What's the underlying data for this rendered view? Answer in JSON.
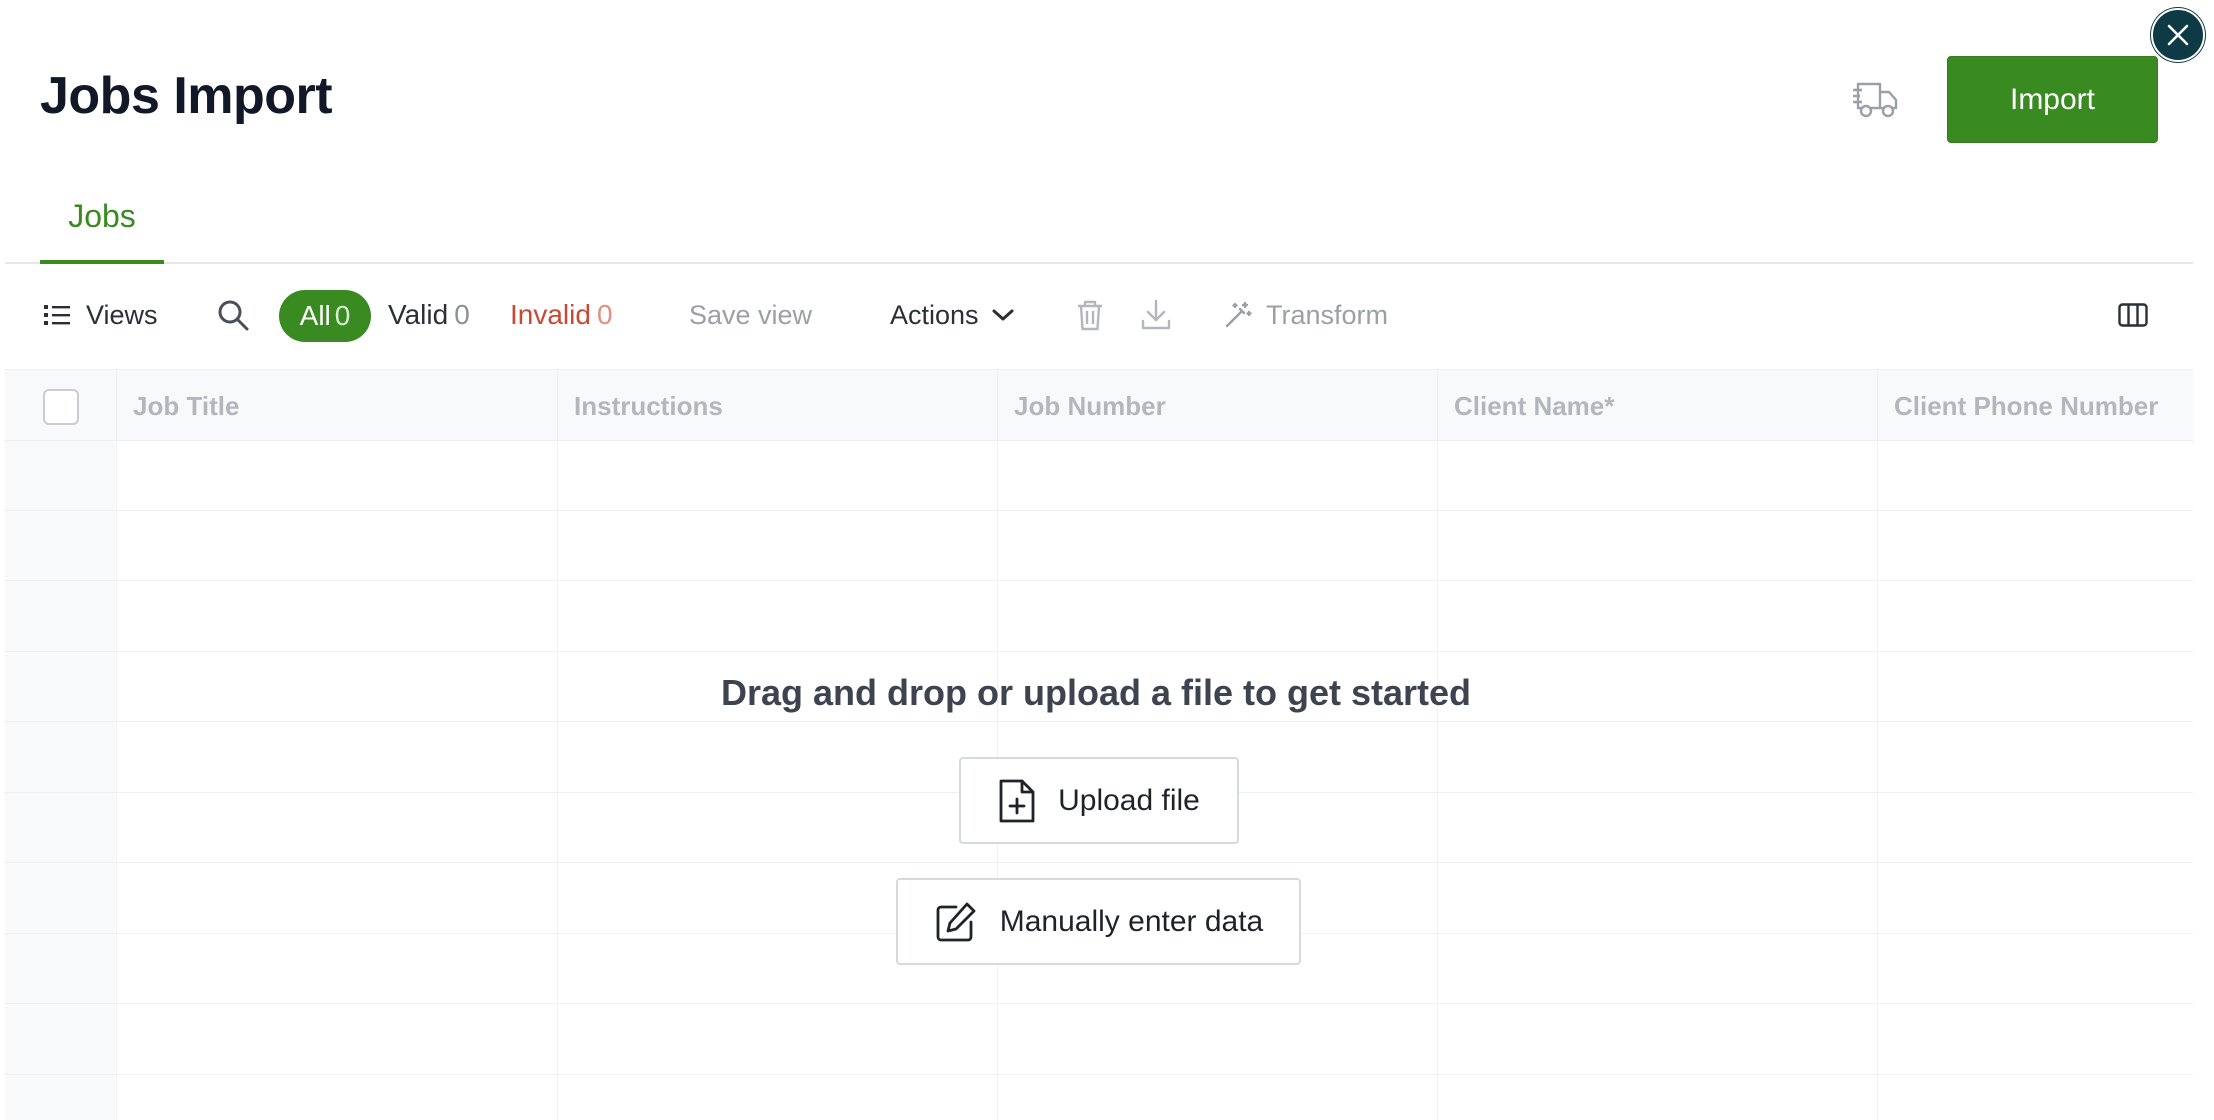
{
  "header": {
    "title": "Jobs Import",
    "import_label": "Import",
    "truck_icon": "truck-icon",
    "close_icon": "close-icon"
  },
  "tabs": [
    {
      "label": "Jobs",
      "active": true
    }
  ],
  "toolbar": {
    "views_label": "Views",
    "filters": {
      "all_label": "All",
      "all_count": "0",
      "valid_label": "Valid",
      "valid_count": "0",
      "invalid_label": "Invalid",
      "invalid_count": "0"
    },
    "save_view_label": "Save view",
    "actions_label": "Actions",
    "transform_label": "Transform"
  },
  "grid": {
    "columns": [
      "Job Title",
      "Instructions",
      "Job Number",
      "Client Name*",
      "Client Phone Number"
    ]
  },
  "empty_state": {
    "message": "Drag and drop or upload a file to get started",
    "upload_label": "Upload file",
    "manual_label": "Manually enter data"
  },
  "colors": {
    "accent": "#3a8a22",
    "invalid": "#c94a34",
    "close_bg": "#0e3a46"
  }
}
